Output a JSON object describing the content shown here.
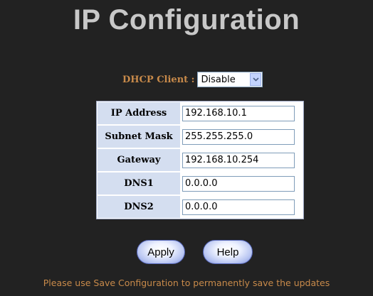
{
  "page": {
    "title": "IP Configuration",
    "note": "Please use Save Configuration to permanently save the updates"
  },
  "dhcp": {
    "label": "DHCP Client :",
    "selected": "Disable"
  },
  "fields": [
    {
      "label": "IP Address",
      "value": "192.168.10.1"
    },
    {
      "label": "Subnet Mask",
      "value": "255.255.255.0"
    },
    {
      "label": "Gateway",
      "value": "192.168.10.254"
    },
    {
      "label": "DNS1",
      "value": "0.0.0.0"
    },
    {
      "label": "DNS2",
      "value": "0.0.0.0"
    }
  ],
  "buttons": {
    "apply": "Apply",
    "help": "Help"
  },
  "colors": {
    "background": "#222222",
    "title": "#c8c8c8",
    "accent_text": "#c88a4a",
    "label_cell": "#d4def0"
  },
  "icons": {
    "dropdown": "chevron-down-icon"
  }
}
